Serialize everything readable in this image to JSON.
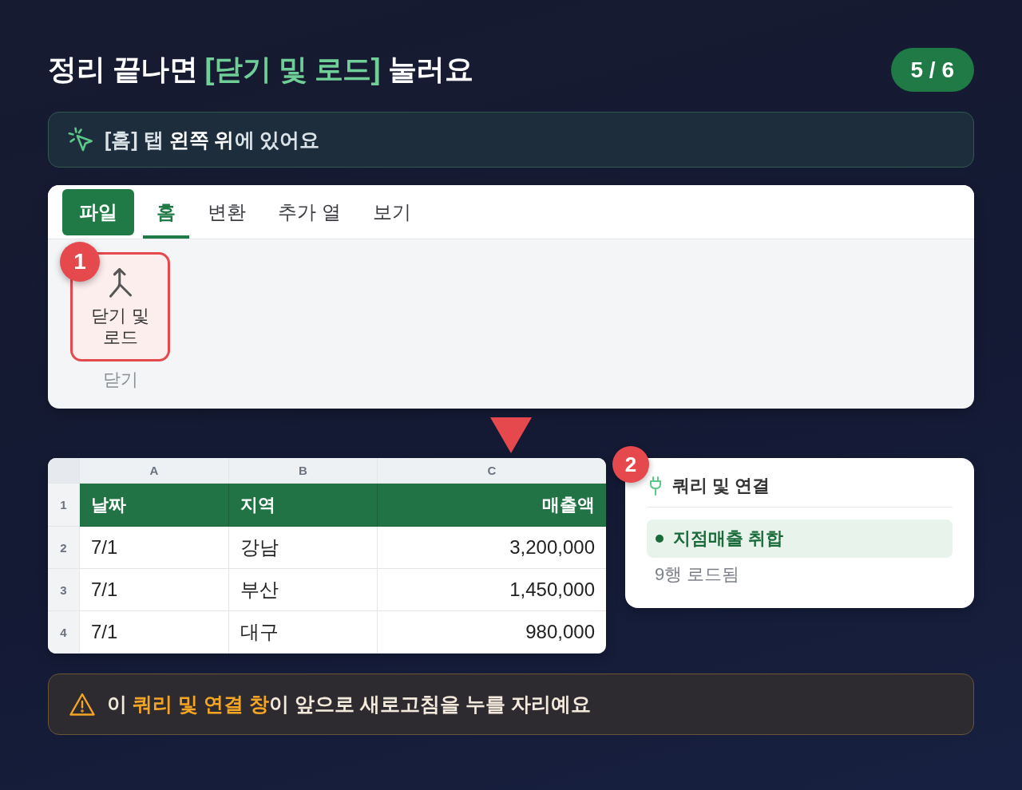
{
  "title": "정리 끝나면 **[닫기 및 로드]** 눌러요",
  "step_counter": "5 / 6",
  "tip": {
    "text": "[홈] 탭 **왼쪽 위**에 있어요"
  },
  "ribbon": {
    "tabs": [
      {
        "label": "파일",
        "kind": "menu",
        "selected": false
      },
      {
        "label": "홈",
        "kind": "tab",
        "selected": true
      },
      {
        "label": "변환",
        "kind": "tab",
        "selected": false
      },
      {
        "label": "추가 열",
        "kind": "tab",
        "selected": false
      },
      {
        "label": "보기",
        "kind": "tab",
        "selected": false
      }
    ],
    "callout": "1",
    "button": {
      "label": "닫기 및 로드",
      "highlighted": true
    },
    "group_label": "닫기"
  },
  "sheet": {
    "columns": [
      {
        "letter": "A",
        "heading": "날짜",
        "kind": "text"
      },
      {
        "letter": "B",
        "heading": "지역",
        "kind": "text"
      },
      {
        "letter": "C",
        "heading": "매출액",
        "kind": "number"
      }
    ],
    "row_numbers": [
      "1",
      "2",
      "3",
      "4"
    ],
    "rows": [
      [
        "7/1",
        "강남",
        "3,200,000"
      ],
      [
        "7/1",
        "부산",
        "1,450,000"
      ],
      [
        "7/1",
        "대구",
        "980,000"
      ]
    ]
  },
  "queries_panel": {
    "callout": "2",
    "title": "쿼리 및 연결",
    "queries": [
      {
        "name": "지점매출 취합",
        "selected": true
      }
    ],
    "status": "9행 로드됨"
  },
  "warning": {
    "text": "이 **쿼리 및 연결 창**이 앞으로 새로고침을 누를 자리예요"
  }
}
